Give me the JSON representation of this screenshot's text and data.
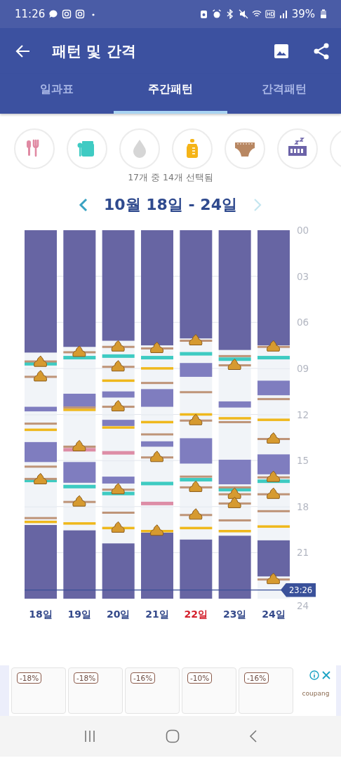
{
  "status_bar": {
    "time": "11:26",
    "battery": "39%"
  },
  "app_bar": {
    "title": "패턴 및 간격"
  },
  "tabs": [
    {
      "label": "일과표",
      "selected": false
    },
    {
      "label": "주간패턴",
      "selected": true
    },
    {
      "label": "간격패턴",
      "selected": false
    }
  ],
  "categories": [
    {
      "kind": "meal"
    },
    {
      "kind": "formula"
    },
    {
      "kind": "water"
    },
    {
      "kind": "bottle"
    },
    {
      "kind": "diaper"
    },
    {
      "kind": "sleep"
    },
    {
      "kind": "more"
    }
  ],
  "selection_summary": "17개 중 14개 선택됨",
  "week_nav": {
    "range": "10월 18일 - 24일",
    "next_disabled": true
  },
  "chart": {
    "hour_labels": [
      "00",
      "03",
      "06",
      "09",
      "12",
      "15",
      "18",
      "21",
      "24"
    ],
    "days": [
      {
        "label": "18일",
        "color": "#34498a"
      },
      {
        "label": "19일",
        "color": "#34498a"
      },
      {
        "label": "20일",
        "color": "#34498a"
      },
      {
        "label": "21일",
        "color": "#34498a"
      },
      {
        "label": "22일",
        "color": "#d4202c"
      },
      {
        "label": "23일",
        "color": "#34498a"
      },
      {
        "label": "24일",
        "color": "#34498a"
      }
    ],
    "current_time": "23:26"
  },
  "ad": {
    "products": [
      {
        "discount": "-18%"
      },
      {
        "discount": "-18%"
      },
      {
        "discount": "-16%"
      },
      {
        "discount": "-10%"
      },
      {
        "discount": "-16%"
      }
    ],
    "brand": "coupang"
  }
}
